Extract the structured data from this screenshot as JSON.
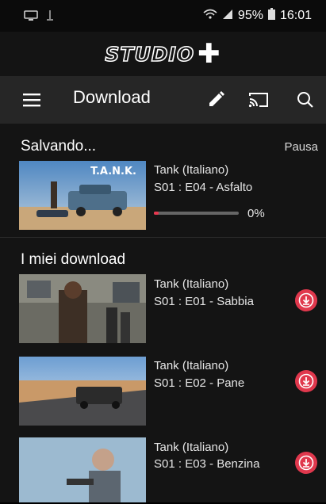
{
  "status_bar": {
    "battery": "95%",
    "time": "16:01"
  },
  "logo": {
    "text": "STUDIO"
  },
  "toolbar": {
    "title": "Download"
  },
  "saving": {
    "title": "Salvando...",
    "pause_label": "Pausa",
    "item": {
      "show": "Tank  (Italiano)",
      "episode": "S01 : E04 - Asfalto",
      "percent": "0%",
      "progress": 0.06,
      "thumb_text": "T.A.N.K."
    }
  },
  "downloads": {
    "title": "I miei download",
    "items": [
      {
        "show": "Tank  (Italiano)",
        "episode": "S01 : E01 - Sabbia"
      },
      {
        "show": "Tank  (Italiano)",
        "episode": "S01 : E02 - Pane"
      },
      {
        "show": "Tank  (Italiano)",
        "episode": "S01 : E03 - Benzina"
      }
    ]
  },
  "colors": {
    "accent": "#e0384d",
    "toolbar": "#262626",
    "background": "#141414"
  }
}
